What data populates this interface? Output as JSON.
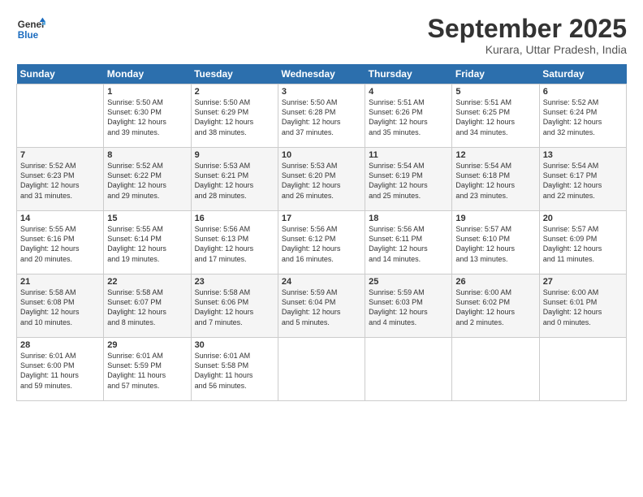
{
  "header": {
    "logo_text_general": "General",
    "logo_text_blue": "Blue",
    "month": "September 2025",
    "location": "Kurara, Uttar Pradesh, India"
  },
  "days_of_week": [
    "Sunday",
    "Monday",
    "Tuesday",
    "Wednesday",
    "Thursday",
    "Friday",
    "Saturday"
  ],
  "weeks": [
    [
      {
        "day": "",
        "info": ""
      },
      {
        "day": "1",
        "info": "Sunrise: 5:50 AM\nSunset: 6:30 PM\nDaylight: 12 hours\nand 39 minutes."
      },
      {
        "day": "2",
        "info": "Sunrise: 5:50 AM\nSunset: 6:29 PM\nDaylight: 12 hours\nand 38 minutes."
      },
      {
        "day": "3",
        "info": "Sunrise: 5:50 AM\nSunset: 6:28 PM\nDaylight: 12 hours\nand 37 minutes."
      },
      {
        "day": "4",
        "info": "Sunrise: 5:51 AM\nSunset: 6:26 PM\nDaylight: 12 hours\nand 35 minutes."
      },
      {
        "day": "5",
        "info": "Sunrise: 5:51 AM\nSunset: 6:25 PM\nDaylight: 12 hours\nand 34 minutes."
      },
      {
        "day": "6",
        "info": "Sunrise: 5:52 AM\nSunset: 6:24 PM\nDaylight: 12 hours\nand 32 minutes."
      }
    ],
    [
      {
        "day": "7",
        "info": "Sunrise: 5:52 AM\nSunset: 6:23 PM\nDaylight: 12 hours\nand 31 minutes."
      },
      {
        "day": "8",
        "info": "Sunrise: 5:52 AM\nSunset: 6:22 PM\nDaylight: 12 hours\nand 29 minutes."
      },
      {
        "day": "9",
        "info": "Sunrise: 5:53 AM\nSunset: 6:21 PM\nDaylight: 12 hours\nand 28 minutes."
      },
      {
        "day": "10",
        "info": "Sunrise: 5:53 AM\nSunset: 6:20 PM\nDaylight: 12 hours\nand 26 minutes."
      },
      {
        "day": "11",
        "info": "Sunrise: 5:54 AM\nSunset: 6:19 PM\nDaylight: 12 hours\nand 25 minutes."
      },
      {
        "day": "12",
        "info": "Sunrise: 5:54 AM\nSunset: 6:18 PM\nDaylight: 12 hours\nand 23 minutes."
      },
      {
        "day": "13",
        "info": "Sunrise: 5:54 AM\nSunset: 6:17 PM\nDaylight: 12 hours\nand 22 minutes."
      }
    ],
    [
      {
        "day": "14",
        "info": "Sunrise: 5:55 AM\nSunset: 6:16 PM\nDaylight: 12 hours\nand 20 minutes."
      },
      {
        "day": "15",
        "info": "Sunrise: 5:55 AM\nSunset: 6:14 PM\nDaylight: 12 hours\nand 19 minutes."
      },
      {
        "day": "16",
        "info": "Sunrise: 5:56 AM\nSunset: 6:13 PM\nDaylight: 12 hours\nand 17 minutes."
      },
      {
        "day": "17",
        "info": "Sunrise: 5:56 AM\nSunset: 6:12 PM\nDaylight: 12 hours\nand 16 minutes."
      },
      {
        "day": "18",
        "info": "Sunrise: 5:56 AM\nSunset: 6:11 PM\nDaylight: 12 hours\nand 14 minutes."
      },
      {
        "day": "19",
        "info": "Sunrise: 5:57 AM\nSunset: 6:10 PM\nDaylight: 12 hours\nand 13 minutes."
      },
      {
        "day": "20",
        "info": "Sunrise: 5:57 AM\nSunset: 6:09 PM\nDaylight: 12 hours\nand 11 minutes."
      }
    ],
    [
      {
        "day": "21",
        "info": "Sunrise: 5:58 AM\nSunset: 6:08 PM\nDaylight: 12 hours\nand 10 minutes."
      },
      {
        "day": "22",
        "info": "Sunrise: 5:58 AM\nSunset: 6:07 PM\nDaylight: 12 hours\nand 8 minutes."
      },
      {
        "day": "23",
        "info": "Sunrise: 5:58 AM\nSunset: 6:06 PM\nDaylight: 12 hours\nand 7 minutes."
      },
      {
        "day": "24",
        "info": "Sunrise: 5:59 AM\nSunset: 6:04 PM\nDaylight: 12 hours\nand 5 minutes."
      },
      {
        "day": "25",
        "info": "Sunrise: 5:59 AM\nSunset: 6:03 PM\nDaylight: 12 hours\nand 4 minutes."
      },
      {
        "day": "26",
        "info": "Sunrise: 6:00 AM\nSunset: 6:02 PM\nDaylight: 12 hours\nand 2 minutes."
      },
      {
        "day": "27",
        "info": "Sunrise: 6:00 AM\nSunset: 6:01 PM\nDaylight: 12 hours\nand 0 minutes."
      }
    ],
    [
      {
        "day": "28",
        "info": "Sunrise: 6:01 AM\nSunset: 6:00 PM\nDaylight: 11 hours\nand 59 minutes."
      },
      {
        "day": "29",
        "info": "Sunrise: 6:01 AM\nSunset: 5:59 PM\nDaylight: 11 hours\nand 57 minutes."
      },
      {
        "day": "30",
        "info": "Sunrise: 6:01 AM\nSunset: 5:58 PM\nDaylight: 11 hours\nand 56 minutes."
      },
      {
        "day": "",
        "info": ""
      },
      {
        "day": "",
        "info": ""
      },
      {
        "day": "",
        "info": ""
      },
      {
        "day": "",
        "info": ""
      }
    ]
  ]
}
